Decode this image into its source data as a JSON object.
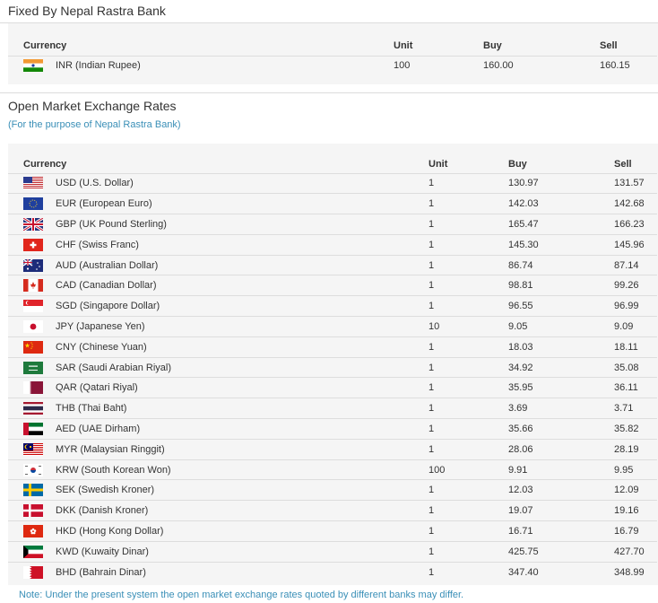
{
  "fixed": {
    "title": "Fixed By Nepal Rastra Bank",
    "headers": {
      "currency": "Currency",
      "unit": "Unit",
      "buy": "Buy",
      "sell": "Sell"
    },
    "rows": [
      {
        "flag": "in-flag-icon",
        "currency": "INR (Indian Rupee)",
        "unit": "100",
        "buy": "160.00",
        "sell": "160.15"
      }
    ]
  },
  "open_market": {
    "title": "Open Market Exchange Rates",
    "subtitle": "(For the purpose of Nepal Rastra Bank)",
    "headers": {
      "currency": "Currency",
      "unit": "Unit",
      "buy": "Buy",
      "sell": "Sell"
    },
    "rows": [
      {
        "flag": "us-flag-icon",
        "currency": "USD (U.S. Dollar)",
        "unit": "1",
        "buy": "130.97",
        "sell": "131.57"
      },
      {
        "flag": "eu-flag-icon",
        "currency": "EUR (European Euro)",
        "unit": "1",
        "buy": "142.03",
        "sell": "142.68"
      },
      {
        "flag": "gb-flag-icon",
        "currency": "GBP (UK Pound Sterling)",
        "unit": "1",
        "buy": "165.47",
        "sell": "166.23"
      },
      {
        "flag": "ch-flag-icon",
        "currency": "CHF (Swiss Franc)",
        "unit": "1",
        "buy": "145.30",
        "sell": "145.96"
      },
      {
        "flag": "au-flag-icon",
        "currency": "AUD (Australian Dollar)",
        "unit": "1",
        "buy": "86.74",
        "sell": "87.14"
      },
      {
        "flag": "ca-flag-icon",
        "currency": "CAD (Canadian Dollar)",
        "unit": "1",
        "buy": "98.81",
        "sell": "99.26"
      },
      {
        "flag": "sg-flag-icon",
        "currency": "SGD (Singapore Dollar)",
        "unit": "1",
        "buy": "96.55",
        "sell": "96.99"
      },
      {
        "flag": "jp-flag-icon",
        "currency": "JPY (Japanese Yen)",
        "unit": "10",
        "buy": "9.05",
        "sell": "9.09"
      },
      {
        "flag": "cn-flag-icon",
        "currency": "CNY (Chinese Yuan)",
        "unit": "1",
        "buy": "18.03",
        "sell": "18.11"
      },
      {
        "flag": "sa-flag-icon",
        "currency": "SAR (Saudi Arabian Riyal)",
        "unit": "1",
        "buy": "34.92",
        "sell": "35.08"
      },
      {
        "flag": "qa-flag-icon",
        "currency": "QAR (Qatari Riyal)",
        "unit": "1",
        "buy": "35.95",
        "sell": "36.11"
      },
      {
        "flag": "th-flag-icon",
        "currency": "THB (Thai Baht)",
        "unit": "1",
        "buy": "3.69",
        "sell": "3.71"
      },
      {
        "flag": "ae-flag-icon",
        "currency": "AED (UAE Dirham)",
        "unit": "1",
        "buy": "35.66",
        "sell": "35.82"
      },
      {
        "flag": "my-flag-icon",
        "currency": "MYR (Malaysian Ringgit)",
        "unit": "1",
        "buy": "28.06",
        "sell": "28.19"
      },
      {
        "flag": "kr-flag-icon",
        "currency": "KRW (South Korean Won)",
        "unit": "100",
        "buy": "9.91",
        "sell": "9.95"
      },
      {
        "flag": "se-flag-icon",
        "currency": "SEK (Swedish Kroner)",
        "unit": "1",
        "buy": "12.03",
        "sell": "12.09"
      },
      {
        "flag": "dk-flag-icon",
        "currency": "DKK (Danish Kroner)",
        "unit": "1",
        "buy": "19.07",
        "sell": "19.16"
      },
      {
        "flag": "hk-flag-icon",
        "currency": "HKD (Hong Kong Dollar)",
        "unit": "1",
        "buy": "16.71",
        "sell": "16.79"
      },
      {
        "flag": "kw-flag-icon",
        "currency": "KWD (Kuwaity Dinar)",
        "unit": "1",
        "buy": "425.75",
        "sell": "427.70"
      },
      {
        "flag": "bh-flag-icon",
        "currency": "BHD (Bahrain Dinar)",
        "unit": "1",
        "buy": "347.40",
        "sell": "348.99"
      }
    ]
  },
  "note": "Note: Under the present system the open market exchange rates quoted by different banks may differ.",
  "colors": {
    "accent": "#3a8fb7",
    "panel": "#f5f5f5",
    "rule": "#dddddd"
  }
}
